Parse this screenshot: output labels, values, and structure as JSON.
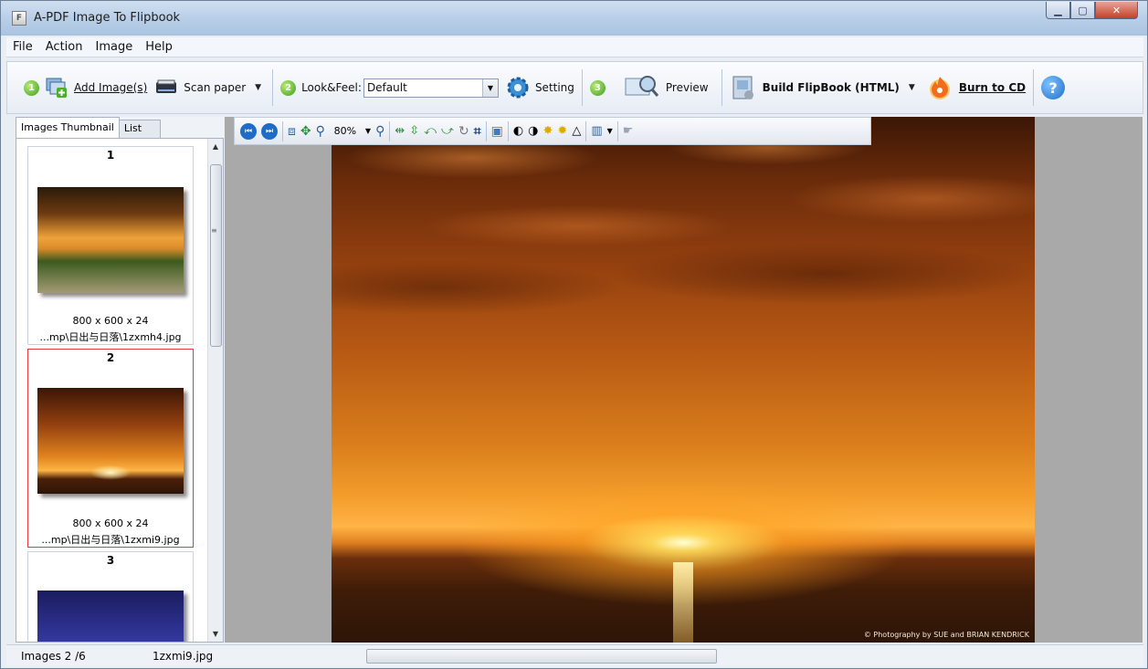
{
  "window": {
    "title": "A-PDF Image To Flipbook",
    "icon_letter": "F",
    "min_glyph": "▁",
    "max_glyph": "▢",
    "close_glyph": "✕"
  },
  "menu": [
    "File",
    "Action",
    "Image",
    "Help"
  ],
  "toolbar": {
    "step1": "1",
    "add_images_label": "Add Image(s)",
    "scan_paper_label": "Scan paper",
    "step2": "2",
    "look_feel_label": "Look&Feel:",
    "look_feel_value": "Default",
    "setting_label": "Setting",
    "step3": "3",
    "preview_label": "Preview",
    "build_label": "Build FlipBook (HTML)",
    "burn_label": "Burn to CD",
    "help_glyph": "?",
    "dropdown_glyph": "▼"
  },
  "left_tabs": {
    "thumbnail": "Images Thumbnail",
    "list": "List"
  },
  "thumbnails": [
    {
      "num": "1",
      "dims": "800 x 600 x 24",
      "file": "...mp\\日出与日落\\1zxmh4.jpg"
    },
    {
      "num": "2",
      "dims": "800 x 600 x 24",
      "file": "...mp\\日出与日落\\1zxmi9.jpg"
    },
    {
      "num": "3",
      "dims": "",
      "file": ""
    }
  ],
  "image_toolbar": {
    "zoom": "80%"
  },
  "photo": {
    "credit": "© Photography by SUE and BRIAN KENDRICK"
  },
  "status": {
    "count": "Images 2 /6",
    "file": "1zxmi9.jpg"
  },
  "colors": {
    "accent": "#3e9d1b",
    "selection": "#e5393b",
    "viewer_bg": "#a9a9a9"
  }
}
